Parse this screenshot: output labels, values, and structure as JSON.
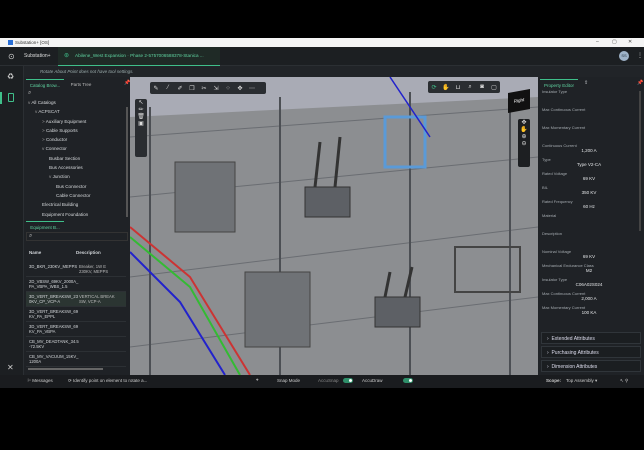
{
  "window": {
    "title": "Substation+ [OS]",
    "min": "–",
    "max": "▢",
    "close": "✕"
  },
  "header": {
    "app_menu": "Substation+",
    "project": "Abilene_West Expansion · Phase 2-5757006588378-Stanica ...",
    "avatar": "SS"
  },
  "tool_settings": "Rotate About Point does not have tool settings.",
  "left_panel": {
    "tabs": [
      "Catalog Brow...",
      "Parts Tree"
    ],
    "tree": [
      {
        "label": "All Catalogs",
        "depth": 0,
        "exp": "v"
      },
      {
        "label": "ACPSCAT",
        "depth": 1,
        "exp": "v"
      },
      {
        "label": "Auxiliary Equipment",
        "depth": 2,
        "exp": ">"
      },
      {
        "label": "Cable Supports",
        "depth": 2,
        "exp": ">"
      },
      {
        "label": "Conductor",
        "depth": 2,
        "exp": ">"
      },
      {
        "label": "Connector",
        "depth": 2,
        "exp": "v"
      },
      {
        "label": "Busbar Section",
        "depth": 3,
        "exp": ""
      },
      {
        "label": "Bus Accessories",
        "depth": 3,
        "exp": ""
      },
      {
        "label": "Junction",
        "depth": 3,
        "exp": "v"
      },
      {
        "label": "Bus Connector",
        "depth": 4,
        "exp": ""
      },
      {
        "label": "Cable Connector",
        "depth": 4,
        "exp": ""
      },
      {
        "label": "Electrical Building",
        "depth": 2,
        "exp": ""
      },
      {
        "label": "Equipment Foundation",
        "depth": 2,
        "exp": ""
      }
    ],
    "equip_tab": "Equipment B...",
    "columns": [
      "Name",
      "Description"
    ],
    "rows": [
      {
        "name": "3D_BKR_230KV_MEPPS",
        "desc": "Breaker, 1W E 230KV, MEPPS"
      },
      {
        "name": "2D_VBSW_69KV_2000A_PA_VBPA_WBS_1.5",
        "desc": ""
      },
      {
        "name": "3D_VERT_BREAKSW_230KV_CP_VCP-A",
        "desc": "VERTICAL BREAK SW, VCP-A"
      },
      {
        "name": "3D_VERT_BREAKSW_69KV_PA_EPPL",
        "desc": ""
      },
      {
        "name": "3D_VERT_BREAKSW_69KV_PA_VBPA",
        "desc": ""
      },
      {
        "name": "CB_MV_DEADTANK_34.5-72.5KV",
        "desc": ""
      },
      {
        "name": "CB_MV_VACUUM_15KV_1200A",
        "desc": ""
      }
    ]
  },
  "right_panel": {
    "tab": "Property Editor",
    "props": [
      {
        "label": "Insulator Type",
        "value": ""
      },
      {
        "label": "Max Continuous Current",
        "value": ""
      },
      {
        "label": "Max Momentary Current",
        "value": ""
      },
      {
        "label": "Continuous Current",
        "value": "1,200 A"
      },
      {
        "label": "Type",
        "value": "Type V2-CA"
      },
      {
        "label": "Rated Voltage",
        "value": "69 KV"
      },
      {
        "label": "BIL",
        "value": "350 KV"
      },
      {
        "label": "Rated Frequency",
        "value": "60 Hz"
      },
      {
        "label": "Material",
        "value": ""
      },
      {
        "label": "Description",
        "value": ""
      },
      {
        "label": "Nominal Voltage",
        "value": "69 KV"
      },
      {
        "label": "Mechanical Endurance Class",
        "value": "M2"
      },
      {
        "label": "Insulator Type",
        "value": "C06A02S024"
      },
      {
        "label": "Max Continuous Current",
        "value": "2,000 A"
      },
      {
        "label": "Max Momentary Current",
        "value": "100 KA"
      }
    ],
    "sections": [
      "Extended Attributes",
      "Purchasing Attributes",
      "Dimension Attributes"
    ]
  },
  "viewport": {
    "view_cube": "Right"
  },
  "status": {
    "messages": "Messages",
    "prompt": "Identify point on element to rotate a...",
    "snap_mode": "Snap Mode",
    "accusnap": "AccuSnap",
    "accudraw": "AccuDraw",
    "scope_label": "Scope:",
    "scope_value": "Top Assembly"
  },
  "colors": {
    "accent": "#3fbf8a",
    "panel": "#1f2226"
  }
}
